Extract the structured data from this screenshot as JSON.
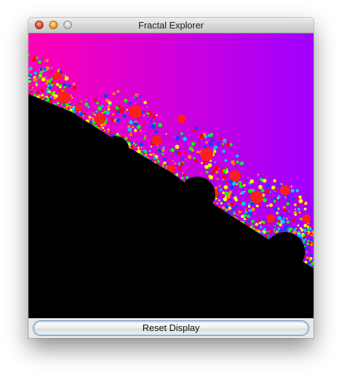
{
  "window": {
    "title": "Fractal Explorer"
  },
  "canvas": {
    "colors": {
      "gradient_start": "#ff00b4",
      "gradient_end": "#a000ff",
      "interior": "#000000",
      "bulb": "#ff1e1e",
      "fringe": [
        "#ff0000",
        "#ffff00",
        "#00ff00",
        "#00c8ff",
        "#0044ff",
        "#ff8800"
      ]
    }
  },
  "controls": {
    "reset_label": "Reset Display"
  }
}
